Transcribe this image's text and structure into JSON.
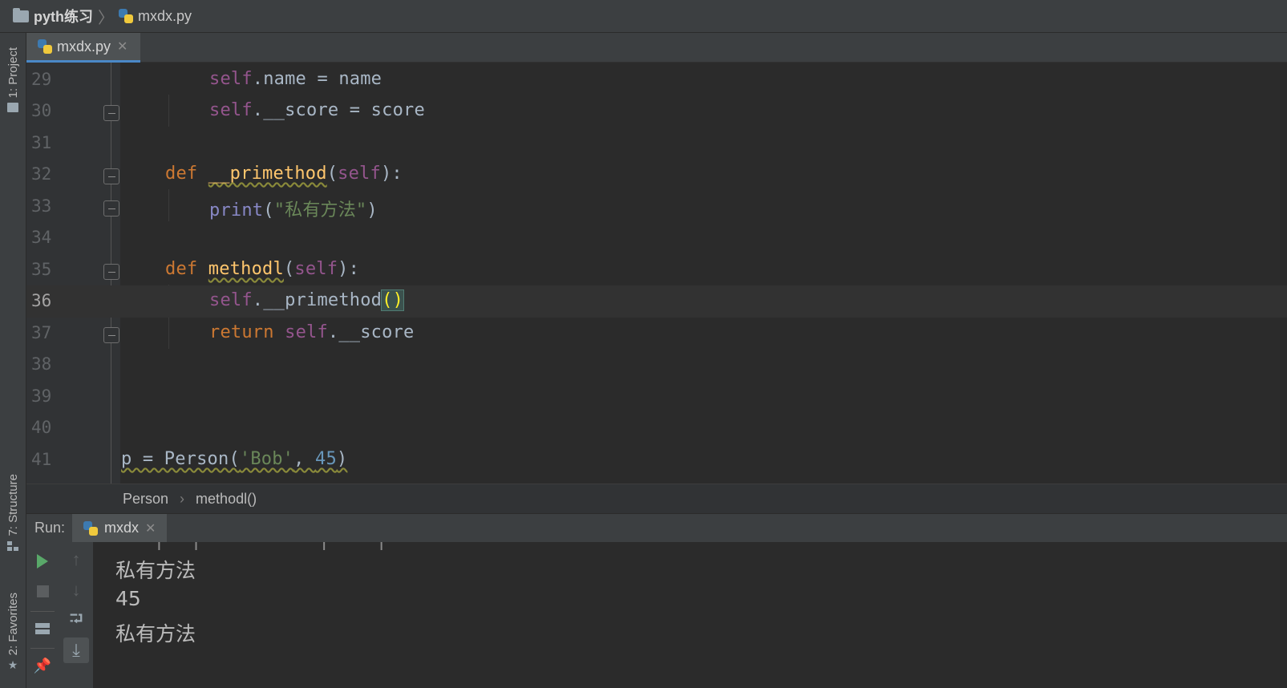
{
  "breadcrumb": {
    "project": "pyth练习",
    "file": "mxdx.py"
  },
  "left_strip": {
    "project_tab": "1: Project",
    "structure_tab": "7: Structure",
    "favorites_tab": "2: Favorites"
  },
  "editor_tab": {
    "label": "mxdx.py"
  },
  "code_lines": [
    {
      "n": "29"
    },
    {
      "n": "30"
    },
    {
      "n": "31"
    },
    {
      "n": "32"
    },
    {
      "n": "33"
    },
    {
      "n": "34"
    },
    {
      "n": "35"
    },
    {
      "n": "36"
    },
    {
      "n": "37"
    },
    {
      "n": "38"
    },
    {
      "n": "39"
    },
    {
      "n": "40"
    },
    {
      "n": "41"
    }
  ],
  "code": {
    "l29": {
      "self": "self",
      "rest": ".name = name"
    },
    "l30": {
      "self": "self",
      "rest": ".__score = score"
    },
    "l32": {
      "def": "def",
      "name": "__primethod",
      "open": "(",
      "self": "self",
      "close": "):"
    },
    "l33": {
      "print": "print",
      "open": "(",
      "str": "\"私有方法\"",
      "close": ")"
    },
    "l35": {
      "def": "def",
      "name": "methodl",
      "open": "(",
      "self": "self",
      "close": "):"
    },
    "l36": {
      "self": "self",
      "rest": ".__primethod",
      "parens": "()"
    },
    "l37": {
      "ret": "return",
      "self": "self",
      "rest": ".__score"
    },
    "l41": {
      "a": "p = Person(",
      "str": "'Bob'",
      "comma": ", ",
      "num": "45",
      "close": ")"
    }
  },
  "scope": {
    "class": "Person",
    "method": "methodl()"
  },
  "run": {
    "label": "Run:",
    "tab": "mxdx"
  },
  "console": {
    "cut_line": "     ▔ ▏▔▔▏      ▔ ▔ ▔    ▔ ▏ ▔  ▔ ▏▔  ▔",
    "lines": [
      "私有方法",
      "45",
      "私有方法"
    ]
  }
}
